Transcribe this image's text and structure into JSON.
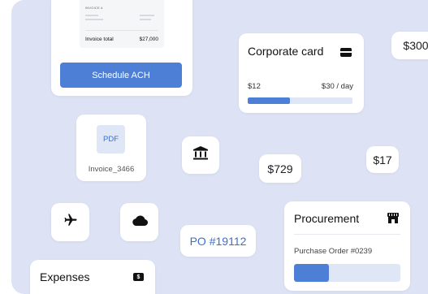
{
  "invoice": {
    "header_label": "INVOICE #",
    "total_label": "Invoice total",
    "total_value": "$27,000",
    "action_label": "Schedule ACH"
  },
  "corporate_card": {
    "title": "Corporate card",
    "icon": "credit-card-icon",
    "spent": "$12",
    "limit": "$30 / day",
    "progress_fraction": 0.4
  },
  "amount_chips": {
    "top_right": "$300",
    "middle": "$729",
    "right": "$17"
  },
  "pdf_file": {
    "badge": "PDF",
    "name": "Invoice_3466"
  },
  "icons": {
    "bank": "bank-icon",
    "plane": "airplane-icon",
    "cloud": "cloud-icon"
  },
  "po_chip": "PO #19112",
  "procurement": {
    "title": "Procurement",
    "icon": "storefront-icon",
    "order": "Purchase Order #0239",
    "progress_fraction": 0.33
  },
  "expenses": {
    "title": "Expenses",
    "icon_text": "$"
  },
  "colors": {
    "background": "#dde3f4",
    "accent": "#4d7fd6",
    "track": "#dfe6f6",
    "card": "#ffffff"
  }
}
